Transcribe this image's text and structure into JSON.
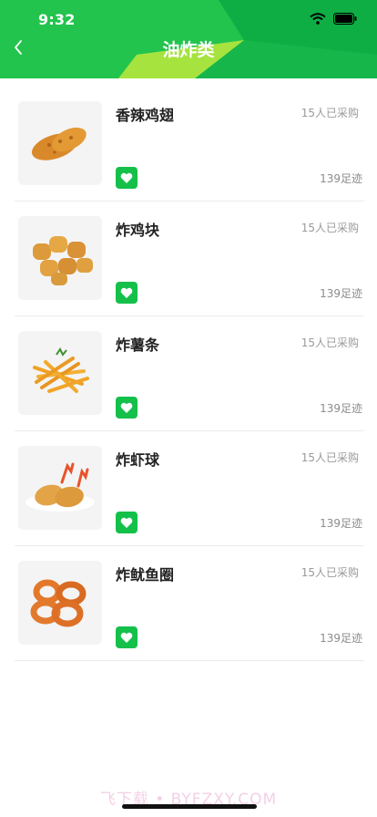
{
  "status_bar": {
    "time": "9:32"
  },
  "nav": {
    "title": "油炸类",
    "back_icon": "chevron-left-icon"
  },
  "colors": {
    "accent": "#14c04a",
    "accent_light": "#9be03b"
  },
  "items": [
    {
      "name": "香辣鸡翅",
      "bought": "15人已采购",
      "footprint": "139足迹",
      "image": "spicy-chicken-wings"
    },
    {
      "name": "炸鸡块",
      "bought": "15人已采购",
      "footprint": "139足迹",
      "image": "chicken-nuggets"
    },
    {
      "name": "炸薯条",
      "bought": "15人已采购",
      "footprint": "139足迹",
      "image": "french-fries"
    },
    {
      "name": "炸虾球",
      "bought": "15人已采购",
      "footprint": "139足迹",
      "image": "fried-shrimp"
    },
    {
      "name": "炸鱿鱼圈",
      "bought": "15人已采购",
      "footprint": "139足迹",
      "image": "fried-squid-rings"
    }
  ],
  "watermark": "飞下载 • BYFZXY.COM"
}
